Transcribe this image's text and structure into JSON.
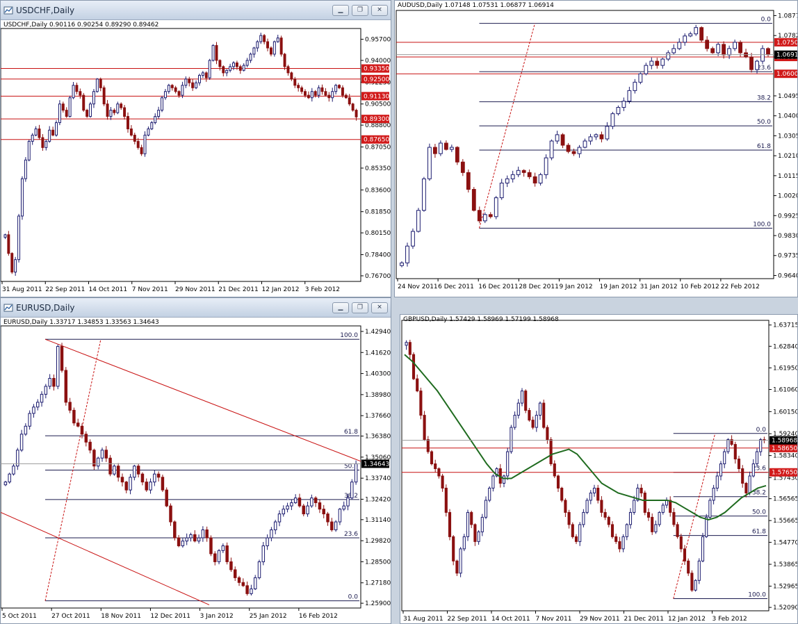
{
  "colors": {
    "up_candle": "#1a1a6e",
    "down_candle": "#8b1010",
    "hline": "#c81010",
    "fib": "#1a1a4e",
    "ma": "#1f6b1f",
    "price_tag_bg": "#d11a1a",
    "current_tag_bg": "#000000"
  },
  "windows": {
    "usdchf": {
      "title": "USDCHF,Daily",
      "icon": "chart-window-icon",
      "ohlc": "USDCHF,Daily  0.90116 0.90254 0.89290 0.89462"
    },
    "audusd": {
      "ohlc": "AUDUSD,Daily  1.07148 1.07531 1.06877 1.06914"
    },
    "eurusd": {
      "title": "EURUSD,Daily",
      "icon": "chart-window-icon",
      "ohlc": "EURUSD,Daily  1.33717 1.34853 1.33563 1.34643"
    },
    "gbpusd": {
      "ohlc": "GBPUSD,Daily  1.57429 1.58969 1.57199 1.58968"
    }
  },
  "chart_data": [
    {
      "id": "usdchf",
      "type": "candlestick",
      "ylim": [
        0.7625,
        0.9645
      ],
      "yticks": [
        "0.95700",
        "0.94000",
        "0.92250",
        "0.90500",
        "0.88800",
        "0.87050",
        "0.85350",
        "0.83600",
        "0.81850",
        "0.80150",
        "0.78400",
        "0.76700"
      ],
      "xticks": [
        "31 Aug 2011",
        "22 Sep 2011",
        "14 Oct 2011",
        "7 Nov 2011",
        "29 Nov 2011",
        "21 Dec 2011",
        "12 Jan 2012",
        "3 Feb 2012"
      ],
      "hlines": [
        {
          "value": 0.9335,
          "label": "0.93350"
        },
        {
          "value": 0.925,
          "label": "0.92500"
        },
        {
          "value": 0.9113,
          "label": "0.91130"
        },
        {
          "value": 0.893,
          "label": "0.89300"
        },
        {
          "value": 0.8765,
          "label": "0.87650"
        }
      ],
      "closes": [
        0.8,
        0.785,
        0.77,
        0.78,
        0.815,
        0.845,
        0.86,
        0.875,
        0.88,
        0.885,
        0.878,
        0.87,
        0.875,
        0.884,
        0.88,
        0.89,
        0.905,
        0.9,
        0.895,
        0.91,
        0.92,
        0.915,
        0.912,
        0.9,
        0.895,
        0.905,
        0.915,
        0.925,
        0.918,
        0.905,
        0.895,
        0.9,
        0.898,
        0.905,
        0.902,
        0.895,
        0.885,
        0.88,
        0.875,
        0.87,
        0.865,
        0.88,
        0.885,
        0.89,
        0.895,
        0.9,
        0.91,
        0.915,
        0.92,
        0.918,
        0.915,
        0.912,
        0.92,
        0.925,
        0.922,
        0.918,
        0.922,
        0.928,
        0.93,
        0.926,
        0.94,
        0.952,
        0.94,
        0.935,
        0.93,
        0.932,
        0.935,
        0.938,
        0.935,
        0.932,
        0.936,
        0.94,
        0.945,
        0.95,
        0.955,
        0.96,
        0.955,
        0.95,
        0.945,
        0.955,
        0.958,
        0.945,
        0.935,
        0.93,
        0.925,
        0.92,
        0.918,
        0.915,
        0.912,
        0.91,
        0.915,
        0.912,
        0.918,
        0.915,
        0.912,
        0.91,
        0.915,
        0.92,
        0.918,
        0.912,
        0.91,
        0.905,
        0.9,
        0.8946
      ]
    },
    {
      "id": "audusd",
      "type": "candlestick",
      "ylim": [
        0.9625,
        1.0895
      ],
      "yticks": [
        "1.0877",
        "1.0782",
        "1.0680",
        "1.0495",
        "1.0400",
        "1.0305",
        "1.0210",
        "1.0115",
        "1.0020",
        "0.9925",
        "0.9830",
        "0.9735",
        "0.9640"
      ],
      "xticks": [
        "24 Nov 2011",
        "6 Dec 2011",
        "16 Dec 2011",
        "28 Dec 2011",
        "9 Jan 2012",
        "19 Jan 2012",
        "31 Jan 2012",
        "10 Feb 2012",
        "22 Feb 2012"
      ],
      "hlines": [
        {
          "value": 1.075,
          "label": "1.0750"
        },
        {
          "value": 1.068,
          "label": "1.0680"
        },
        {
          "value": 1.06,
          "label": "1.0600"
        }
      ],
      "current_tag": "1.0691",
      "fib": {
        "high": 1.084,
        "low": 0.9865,
        "levels": [
          [
            "0.0",
            1.084
          ],
          [
            "23.6",
            1.061
          ],
          [
            "38.2",
            1.0467
          ],
          [
            "50.0",
            1.0352
          ],
          [
            "61.8",
            1.0237
          ],
          [
            "100.0",
            0.9865
          ]
        ]
      },
      "closes": [
        0.97,
        0.978,
        0.985,
        0.995,
        1.01,
        1.025,
        1.022,
        1.027,
        1.024,
        1.025,
        1.018,
        1.013,
        1.005,
        0.995,
        0.99,
        0.993,
        0.992,
        1.001,
        1.008,
        1.01,
        1.012,
        1.014,
        1.013,
        1.011,
        1.008,
        1.012,
        1.02,
        1.028,
        1.031,
        1.026,
        1.023,
        1.022,
        1.025,
        1.028,
        1.03,
        1.031,
        1.029,
        1.035,
        1.041,
        1.044,
        1.047,
        1.052,
        1.056,
        1.06,
        1.064,
        1.066,
        1.064,
        1.067,
        1.07,
        1.072,
        1.075,
        1.078,
        1.079,
        1.082,
        1.076,
        1.072,
        1.07,
        1.074,
        1.069,
        1.072,
        1.075,
        1.07,
        1.068,
        1.062,
        1.066,
        1.072,
        1.0691
      ]
    },
    {
      "id": "eurusd",
      "type": "candlestick",
      "ylim": [
        1.256,
        1.432
      ],
      "yticks": [
        "1.42940",
        "1.41620",
        "1.40300",
        "1.38980",
        "1.37660",
        "1.36380",
        "1.35060",
        "1.33740",
        "1.32420",
        "1.31140",
        "1.29820",
        "1.28500",
        "1.27180",
        "1.25900"
      ],
      "xticks": [
        "5 Oct 2011",
        "27 Oct 2011",
        "18 Nov 2011",
        "12 Dec 2011",
        "3 Jan 2012",
        "25 Jan 2012",
        "16 Feb 2012"
      ],
      "current_tag": "1.34643",
      "fib": {
        "high": 1.4245,
        "low": 1.2605,
        "levels": [
          [
            "100.0",
            1.4245
          ],
          [
            "61.8",
            1.364
          ],
          [
            "50.0",
            1.3425
          ],
          [
            "38.2",
            1.324
          ],
          [
            "23.6",
            1.3
          ],
          [
            "0.0",
            1.2605
          ]
        ]
      },
      "closes": [
        1.335,
        1.34,
        1.345,
        1.355,
        1.365,
        1.37,
        1.378,
        1.382,
        1.385,
        1.39,
        1.395,
        1.4,
        1.395,
        1.42,
        1.405,
        1.385,
        1.38,
        1.372,
        1.37,
        1.365,
        1.36,
        1.355,
        1.345,
        1.35,
        1.355,
        1.35,
        1.34,
        1.345,
        1.338,
        1.335,
        1.33,
        1.338,
        1.345,
        1.34,
        1.335,
        1.33,
        1.335,
        1.34,
        1.338,
        1.33,
        1.32,
        1.31,
        1.3,
        1.295,
        1.298,
        1.3,
        1.302,
        1.298,
        1.3,
        1.305,
        1.3,
        1.29,
        1.285,
        1.292,
        1.295,
        1.285,
        1.28,
        1.275,
        1.272,
        1.27,
        1.265,
        1.268,
        1.275,
        1.285,
        1.295,
        1.3,
        1.305,
        1.31,
        1.315,
        1.318,
        1.32,
        1.322,
        1.325,
        1.32,
        1.315,
        1.32,
        1.325,
        1.322,
        1.318,
        1.315,
        1.31,
        1.305,
        1.31,
        1.318,
        1.32,
        1.325,
        1.335,
        1.3464
      ]
    },
    {
      "id": "gbpusd",
      "type": "candlestick",
      "ylim": [
        1.5195,
        1.6385
      ],
      "yticks": [
        "1.63715",
        "1.62840",
        "1.61950",
        "1.61060",
        "1.60150",
        "1.59240",
        "1.58340",
        "1.57430",
        "1.56565",
        "1.55665",
        "1.54770",
        "1.53865",
        "1.52965",
        "1.52090"
      ],
      "xticks": [
        "31 Aug 2011",
        "22 Sep 2011",
        "14 Oct 2011",
        "7 Nov 2011",
        "29 Nov 2011",
        "21 Dec 2011",
        "12 Jan 2012",
        "3 Feb 2012"
      ],
      "hlines": [
        {
          "value": 1.5865,
          "label": "1.58650"
        },
        {
          "value": 1.5765,
          "label": "1.57650"
        }
      ],
      "current_tag": "1.58968",
      "fib": {
        "high": 1.5925,
        "low": 1.5245,
        "levels": [
          [
            "0.0",
            1.5925
          ],
          [
            "23.6",
            1.5765
          ],
          [
            "38.2",
            1.5665
          ],
          [
            "50.0",
            1.5585
          ],
          [
            "61.8",
            1.5505
          ],
          [
            "100.0",
            1.5245
          ]
        ]
      },
      "closes": [
        1.63,
        1.625,
        1.615,
        1.61,
        1.6,
        1.59,
        1.585,
        1.58,
        1.578,
        1.575,
        1.57,
        1.56,
        1.55,
        1.54,
        1.535,
        1.545,
        1.55,
        1.56,
        1.555,
        1.548,
        1.552,
        1.558,
        1.565,
        1.57,
        1.575,
        1.578,
        1.572,
        1.575,
        1.585,
        1.595,
        1.6,
        1.605,
        1.61,
        1.602,
        1.598,
        1.595,
        1.6,
        1.605,
        1.595,
        1.59,
        1.58,
        1.575,
        1.57,
        1.565,
        1.56,
        1.555,
        1.55,
        1.548,
        1.555,
        1.56,
        1.565,
        1.568,
        1.57,
        1.565,
        1.56,
        1.558,
        1.555,
        1.55,
        1.548,
        1.545,
        1.55,
        1.555,
        1.56,
        1.565,
        1.57,
        1.568,
        1.56,
        1.558,
        1.552,
        1.555,
        1.56,
        1.563,
        1.565,
        1.56,
        1.555,
        1.55,
        1.545,
        1.54,
        1.535,
        1.528,
        1.532,
        1.54,
        1.55,
        1.558,
        1.565,
        1.57,
        1.575,
        1.58,
        1.585,
        1.59,
        1.588,
        1.582,
        1.578,
        1.572,
        1.568,
        1.575,
        1.58,
        1.585,
        1.59,
        1.5897
      ],
      "ma": [
        1.625,
        1.622,
        1.618,
        1.614,
        1.61,
        1.605,
        1.6,
        1.595,
        1.59,
        1.585,
        1.58,
        1.576,
        1.574,
        1.574,
        1.576,
        1.578,
        1.58,
        1.582,
        1.584,
        1.585,
        1.586,
        1.584,
        1.58,
        1.576,
        1.572,
        1.57,
        1.568,
        1.567,
        1.566,
        1.565,
        1.565,
        1.565,
        1.565,
        1.564,
        1.562,
        1.56,
        1.558,
        1.557,
        1.558,
        1.56,
        1.563,
        1.566,
        1.568,
        1.57,
        1.571
      ]
    }
  ]
}
